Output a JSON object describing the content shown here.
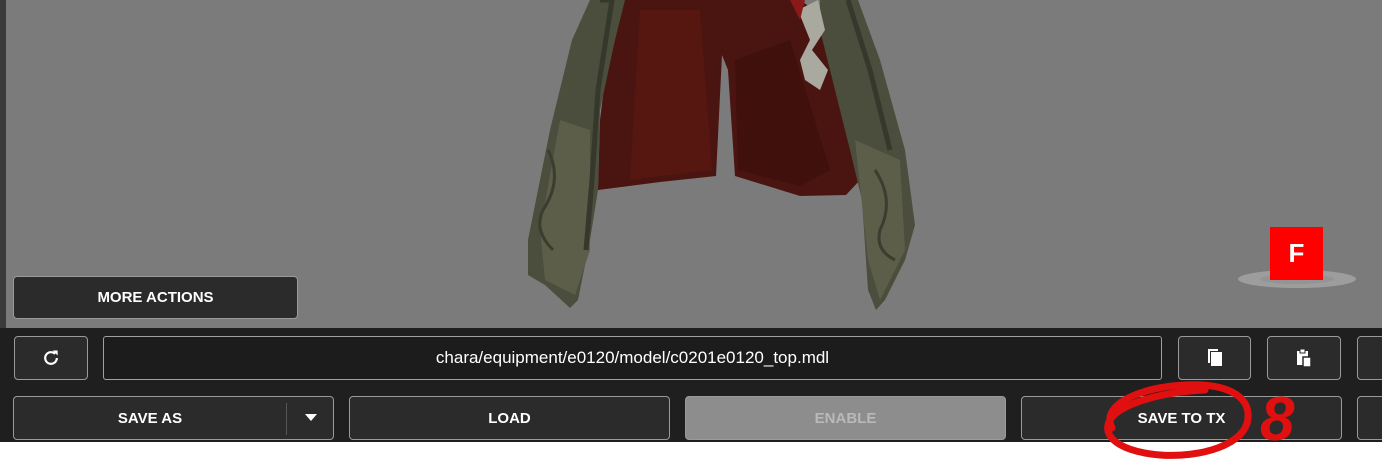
{
  "viewport": {
    "more_actions_label": "MORE ACTIONS",
    "gizmo_label": "F",
    "background_color": "#7b7b7b"
  },
  "toolbar": {
    "refresh_icon": "refresh-icon",
    "file_path": "chara/equipment/e0120/model/c0201e0120_top.mdl",
    "copy_icon": "copy-icon",
    "paste_icon": "paste-icon",
    "save_as_label": "SAVE AS",
    "save_as_dropdown_icon": "caret-down-icon",
    "load_label": "LOAD",
    "enable_label": "ENABLE",
    "save_to_tx_label": "SAVE TO TX"
  },
  "annotation": {
    "number": "8",
    "color": "#e01010"
  }
}
